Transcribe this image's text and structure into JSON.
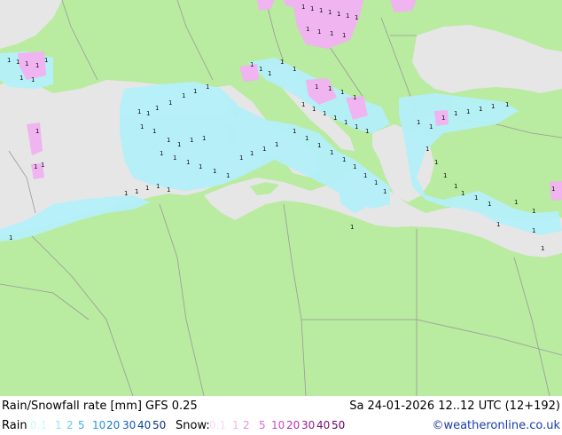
{
  "title": "Rain/Snowfall rate [mm] GFS 0.25",
  "datetime": "Sa 24-01-2026 12..12 UTC (12+192)",
  "rain_label": "Rain",
  "rain_scale": [
    {
      "label": "0.1",
      "color": "#c8fafa"
    },
    {
      "label": "1",
      "color": "#8ee8f5"
    },
    {
      "label": "2",
      "color": "#5ad0f0"
    },
    {
      "label": "5",
      "color": "#36b4ea"
    },
    {
      "label": "10",
      "color": "#1d96e0"
    },
    {
      "label": "20",
      "color": "#1278c8"
    },
    {
      "label": "30",
      "color": "#0d5eb0"
    },
    {
      "label": "40",
      "color": "#0a4696"
    },
    {
      "label": "50",
      "color": "#08307c"
    }
  ],
  "snow_label": "Snow:",
  "snow_scale": [
    {
      "label": "0.1",
      "color": "#f8d8f8"
    },
    {
      "label": "1",
      "color": "#f0b4f0"
    },
    {
      "label": "2",
      "color": "#e890e8"
    },
    {
      "label": "5",
      "color": "#d86cd8"
    },
    {
      "label": "10",
      "color": "#c84cc8"
    },
    {
      "label": "20",
      "color": "#b030b0"
    },
    {
      "label": "30",
      "color": "#901c90"
    },
    {
      "label": "40",
      "color": "#780c78"
    },
    {
      "label": "50",
      "color": "#600060"
    }
  ],
  "credit": "©weatheronline.co.uk",
  "colors": {
    "land": "#b9eba0",
    "sea": "#e6e6e6",
    "rain_light": "#b4f0fa",
    "rain_mid": "#8ee8f5",
    "snow_light": "#f0b4f0",
    "border": "#9a9a9a",
    "credit": "#1a3ca8"
  },
  "region_icon": "mediterranean-precipitation-map"
}
